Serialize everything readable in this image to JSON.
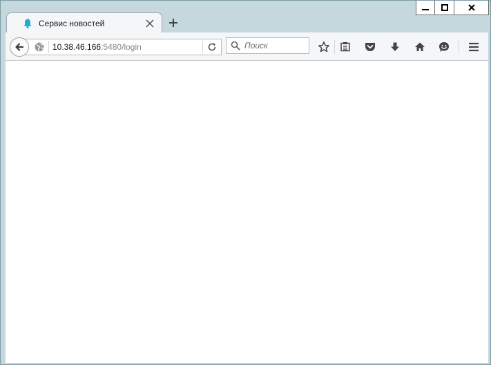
{
  "window": {
    "controls": [
      "minimize",
      "maximize",
      "close"
    ]
  },
  "tab": {
    "title": "Сервис новостей",
    "favicon": "bell-icon",
    "accent": "#1cb0d8"
  },
  "address": {
    "host": "10.38.46.166",
    "path": ":5480/login"
  },
  "search": {
    "placeholder": "Поиск"
  },
  "toolbar": {
    "icons": [
      "star-icon",
      "reading-list-icon",
      "pocket-icon",
      "download-icon",
      "home-icon",
      "smiley-icon",
      "menu-icon"
    ]
  }
}
